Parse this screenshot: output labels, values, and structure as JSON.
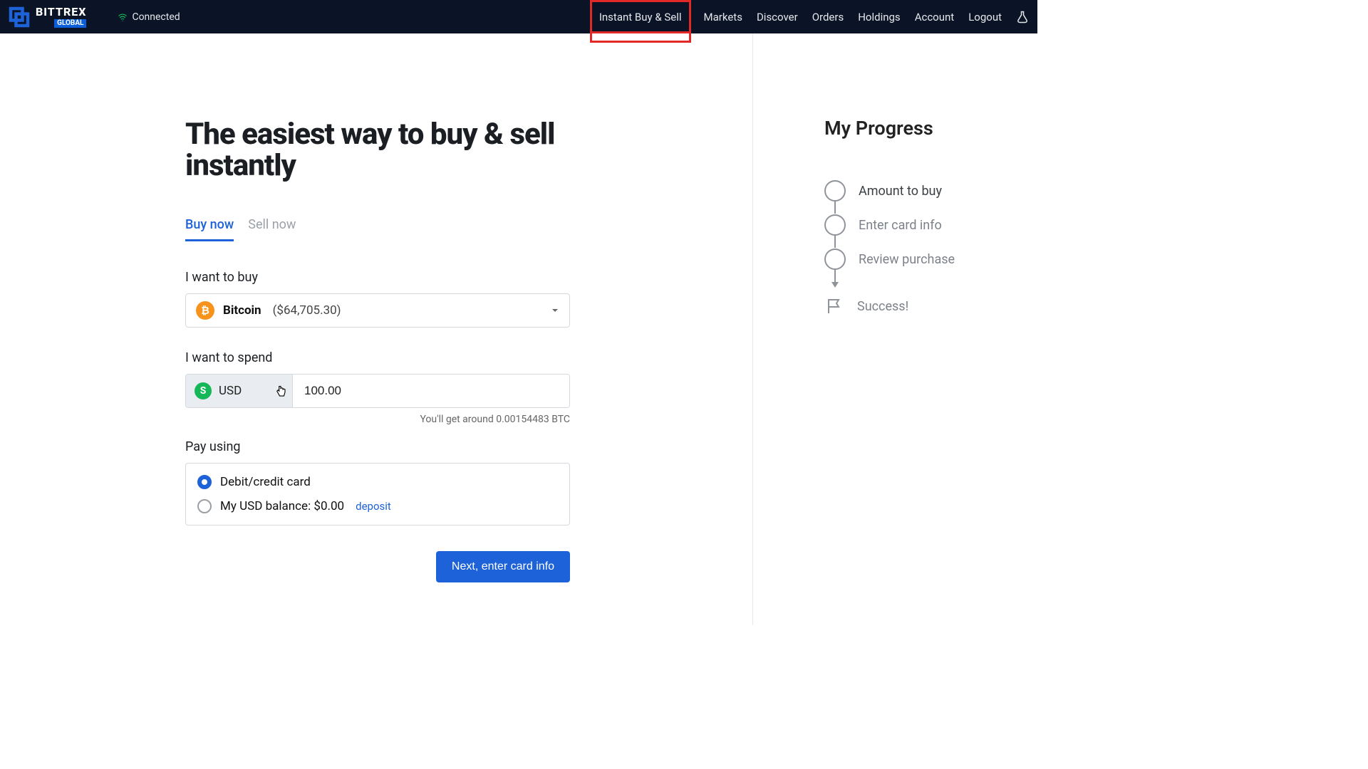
{
  "header": {
    "brand": "BITTREX",
    "sub": "GLOBAL",
    "connected": "Connected",
    "nav": {
      "instant": "Instant Buy & Sell",
      "markets": "Markets",
      "discover": "Discover",
      "orders": "Orders",
      "holdings": "Holdings",
      "account": "Account",
      "logout": "Logout"
    }
  },
  "main": {
    "headline": "The easiest way to buy & sell instantly",
    "tabs": {
      "buy": "Buy now",
      "sell": "Sell now"
    },
    "buy_label": "I want to buy",
    "coin": {
      "name": "Bitcoin",
      "price": "($64,705.30)"
    },
    "spend_label": "I want to spend",
    "currency": {
      "code": "USD",
      "symbol": "S"
    },
    "amount": "100.00",
    "estimate": "You'll get around 0.00154483 BTC",
    "pay_label": "Pay using",
    "pay_card": "Debit/credit card",
    "pay_balance_prefix": "My USD balance: $",
    "pay_balance_amount": "0.00",
    "deposit": "deposit",
    "next": "Next, enter card info"
  },
  "side": {
    "title": "My Progress",
    "steps": {
      "amount": "Amount to buy",
      "card": "Enter card info",
      "review": "Review purchase",
      "success": "Success!"
    }
  }
}
